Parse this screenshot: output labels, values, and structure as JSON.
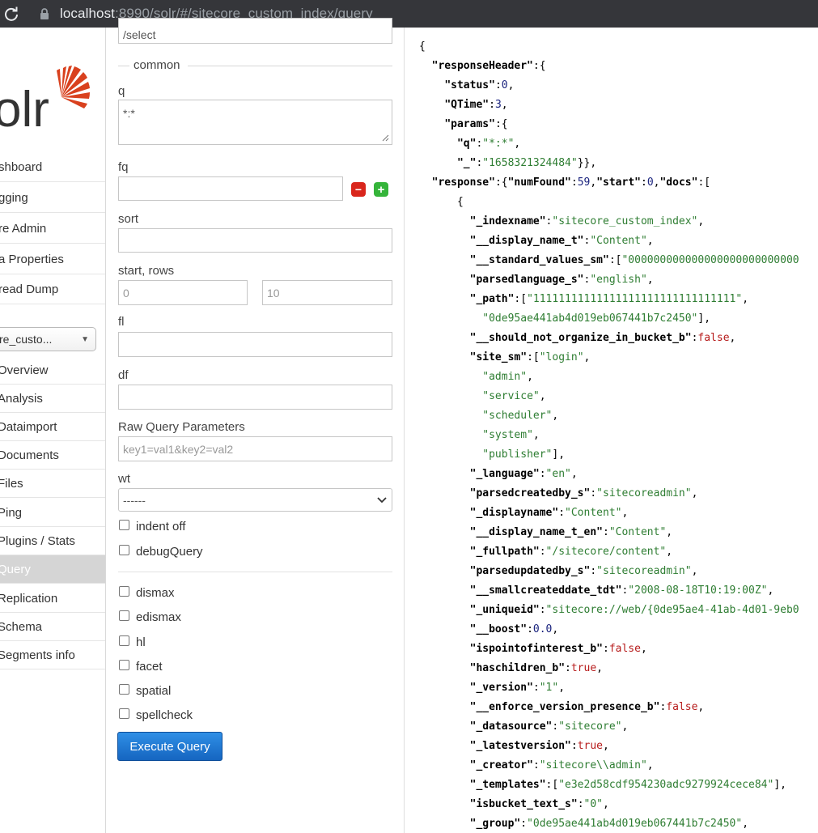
{
  "browser": {
    "url_host": "localhost",
    "url_rest": ":8990/solr/#/sitecore_custom_index/query"
  },
  "nav": {
    "logo_text": "olr",
    "items": [
      "shboard",
      "gging",
      "re Admin",
      "a Properties",
      "read Dump"
    ],
    "core_selected": "re_custo...",
    "core_items": [
      "Overview",
      "Analysis",
      "Dataimport",
      "Documents",
      "Files",
      "Ping",
      "Plugins / Stats",
      "Query",
      "Replication",
      "Schema",
      "Segments info"
    ],
    "active_core_item": "Query"
  },
  "form": {
    "handler_value": "/select",
    "common_legend": "common",
    "q_label": "q",
    "q_value": "*:*",
    "fq_label": "fq",
    "sort_label": "sort",
    "start_rows_label": "start, rows",
    "start_value": "0",
    "rows_value": "10",
    "fl_label": "fl",
    "df_label": "df",
    "raw_label": "Raw Query Parameters",
    "raw_placeholder": "key1=val1&key2=val2",
    "wt_label": "wt",
    "wt_value": "------",
    "indent_label": "indent off",
    "debug_label": "debugQuery",
    "options": [
      "dismax",
      "edismax",
      "hl",
      "facet",
      "spatial",
      "spellcheck"
    ],
    "execute_label": "Execute Query"
  },
  "response_json": [
    [
      [
        "p",
        "{"
      ]
    ],
    [
      [
        "i",
        "  "
      ],
      [
        "k",
        "\"responseHeader\""
      ],
      [
        "p",
        "\":{"
      ]
    ],
    [
      [
        "i",
        "    "
      ],
      [
        "k",
        "\"status\""
      ],
      [
        "p",
        ":"
      ],
      [
        "n",
        "0"
      ],
      [
        "p",
        ","
      ]
    ],
    [
      [
        "i",
        "    "
      ],
      [
        "k",
        "\"QTime\""
      ],
      [
        "p",
        ":"
      ],
      [
        "n",
        "3"
      ],
      [
        "p",
        ","
      ]
    ],
    [
      [
        "i",
        "    "
      ],
      [
        "k",
        "\"params\""
      ],
      [
        "p",
        ":{"
      ]
    ],
    [
      [
        "i",
        "      "
      ],
      [
        "k",
        "\"q\""
      ],
      [
        "p",
        ":"
      ],
      [
        "s",
        "\"*:*\""
      ],
      [
        "p",
        ","
      ]
    ],
    [
      [
        "i",
        "      "
      ],
      [
        "k",
        "\"_\""
      ],
      [
        "p",
        ":"
      ],
      [
        "s",
        "\"1658321324484\""
      ],
      [
        "p",
        "}},"
      ]
    ],
    [
      [
        "i",
        "  "
      ],
      [
        "k",
        "\"response\""
      ],
      [
        "p",
        ":{"
      ],
      [
        "k",
        "\"numFound\""
      ],
      [
        "p",
        ":"
      ],
      [
        "n",
        "59"
      ],
      [
        "p",
        ","
      ],
      [
        "k",
        "\"start\""
      ],
      [
        "p",
        ":"
      ],
      [
        "n",
        "0"
      ],
      [
        "p",
        ","
      ],
      [
        "k",
        "\"docs\""
      ],
      [
        "p",
        ":["
      ]
    ],
    [
      [
        "i",
        "      "
      ],
      [
        "p",
        "{"
      ]
    ],
    [
      [
        "i",
        "        "
      ],
      [
        "k",
        "\"_indexname\""
      ],
      [
        "p",
        ":"
      ],
      [
        "s",
        "\"sitecore_custom_index\""
      ],
      [
        "p",
        ","
      ]
    ],
    [
      [
        "i",
        "        "
      ],
      [
        "k",
        "\"__display_name_t\""
      ],
      [
        "p",
        ":"
      ],
      [
        "s",
        "\"Content\""
      ],
      [
        "p",
        ","
      ]
    ],
    [
      [
        "i",
        "        "
      ],
      [
        "k",
        "\"__standard_values_sm\""
      ],
      [
        "p",
        ":["
      ],
      [
        "s",
        "\"000000000000000000000000000"
      ]
    ],
    [
      [
        "i",
        "        "
      ],
      [
        "k",
        "\"parsedlanguage_s\""
      ],
      [
        "p",
        ":"
      ],
      [
        "s",
        "\"english\""
      ],
      [
        "p",
        ","
      ]
    ],
    [
      [
        "i",
        "        "
      ],
      [
        "k",
        "\"_path\""
      ],
      [
        "p",
        ":["
      ],
      [
        "s",
        "\"11111111111111111111111111111111\""
      ],
      [
        "p",
        ","
      ]
    ],
    [
      [
        "i",
        "          "
      ],
      [
        "s",
        "\"0de95ae441ab4d019eb067441b7c2450\""
      ],
      [
        "p",
        "],"
      ]
    ],
    [
      [
        "i",
        "        "
      ],
      [
        "k",
        "\"__should_not_organize_in_bucket_b\""
      ],
      [
        "p",
        ":"
      ],
      [
        "b",
        "false"
      ],
      [
        "p",
        ","
      ]
    ],
    [
      [
        "i",
        "        "
      ],
      [
        "k",
        "\"site_sm\""
      ],
      [
        "p",
        ":["
      ],
      [
        "s",
        "\"login\""
      ],
      [
        "p",
        ","
      ]
    ],
    [
      [
        "i",
        "          "
      ],
      [
        "s",
        "\"admin\""
      ],
      [
        "p",
        ","
      ]
    ],
    [
      [
        "i",
        "          "
      ],
      [
        "s",
        "\"service\""
      ],
      [
        "p",
        ","
      ]
    ],
    [
      [
        "i",
        "          "
      ],
      [
        "s",
        "\"scheduler\""
      ],
      [
        "p",
        ","
      ]
    ],
    [
      [
        "i",
        "          "
      ],
      [
        "s",
        "\"system\""
      ],
      [
        "p",
        ","
      ]
    ],
    [
      [
        "i",
        "          "
      ],
      [
        "s",
        "\"publisher\""
      ],
      [
        "p",
        "],"
      ]
    ],
    [
      [
        "i",
        "        "
      ],
      [
        "k",
        "\"_language\""
      ],
      [
        "p",
        ":"
      ],
      [
        "s",
        "\"en\""
      ],
      [
        "p",
        ","
      ]
    ],
    [
      [
        "i",
        "        "
      ],
      [
        "k",
        "\"parsedcreatedby_s\""
      ],
      [
        "p",
        ":"
      ],
      [
        "s",
        "\"sitecoreadmin\""
      ],
      [
        "p",
        ","
      ]
    ],
    [
      [
        "i",
        "        "
      ],
      [
        "k",
        "\"_displayname\""
      ],
      [
        "p",
        ":"
      ],
      [
        "s",
        "\"Content\""
      ],
      [
        "p",
        ","
      ]
    ],
    [
      [
        "i",
        "        "
      ],
      [
        "k",
        "\"__display_name_t_en\""
      ],
      [
        "p",
        ":"
      ],
      [
        "s",
        "\"Content\""
      ],
      [
        "p",
        ","
      ]
    ],
    [
      [
        "i",
        "        "
      ],
      [
        "k",
        "\"_fullpath\""
      ],
      [
        "p",
        ":"
      ],
      [
        "s",
        "\"/sitecore/content\""
      ],
      [
        "p",
        ","
      ]
    ],
    [
      [
        "i",
        "        "
      ],
      [
        "k",
        "\"parsedupdatedby_s\""
      ],
      [
        "p",
        ":"
      ],
      [
        "s",
        "\"sitecoreadmin\""
      ],
      [
        "p",
        ","
      ]
    ],
    [
      [
        "i",
        "        "
      ],
      [
        "k",
        "\"__smallcreateddate_tdt\""
      ],
      [
        "p",
        ":"
      ],
      [
        "s",
        "\"2008-08-18T10:19:00Z\""
      ],
      [
        "p",
        ","
      ]
    ],
    [
      [
        "i",
        "        "
      ],
      [
        "k",
        "\"_uniqueid\""
      ],
      [
        "p",
        ":"
      ],
      [
        "s",
        "\"sitecore://web/{0de95ae4-41ab-4d01-9eb0"
      ]
    ],
    [
      [
        "i",
        "        "
      ],
      [
        "k",
        "\"__boost\""
      ],
      [
        "p",
        ":"
      ],
      [
        "n",
        "0.0"
      ],
      [
        "p",
        ","
      ]
    ],
    [
      [
        "i",
        "        "
      ],
      [
        "k",
        "\"ispointofinterest_b\""
      ],
      [
        "p",
        ":"
      ],
      [
        "b",
        "false"
      ],
      [
        "p",
        ","
      ]
    ],
    [
      [
        "i",
        "        "
      ],
      [
        "k",
        "\"haschildren_b\""
      ],
      [
        "p",
        ":"
      ],
      [
        "b",
        "true"
      ],
      [
        "p",
        ","
      ]
    ],
    [
      [
        "i",
        "        "
      ],
      [
        "k",
        "\"_version\""
      ],
      [
        "p",
        ":"
      ],
      [
        "s",
        "\"1\""
      ],
      [
        "p",
        ","
      ]
    ],
    [
      [
        "i",
        "        "
      ],
      [
        "k",
        "\"__enforce_version_presence_b\""
      ],
      [
        "p",
        ":"
      ],
      [
        "b",
        "false"
      ],
      [
        "p",
        ","
      ]
    ],
    [
      [
        "i",
        "        "
      ],
      [
        "k",
        "\"_datasource\""
      ],
      [
        "p",
        ":"
      ],
      [
        "s",
        "\"sitecore\""
      ],
      [
        "p",
        ","
      ]
    ],
    [
      [
        "i",
        "        "
      ],
      [
        "k",
        "\"_latestversion\""
      ],
      [
        "p",
        ":"
      ],
      [
        "b",
        "true"
      ],
      [
        "p",
        ","
      ]
    ],
    [
      [
        "i",
        "        "
      ],
      [
        "k",
        "\"_creator\""
      ],
      [
        "p",
        ":"
      ],
      [
        "s",
        "\"sitecore\\\\admin\""
      ],
      [
        "p",
        ","
      ]
    ],
    [
      [
        "i",
        "        "
      ],
      [
        "k",
        "\"_templates\""
      ],
      [
        "p",
        ":["
      ],
      [
        "s",
        "\"e3e2d58cdf954230adc9279924cece84\""
      ],
      [
        "p",
        "],"
      ]
    ],
    [
      [
        "i",
        "        "
      ],
      [
        "k",
        "\"isbucket_text_s\""
      ],
      [
        "p",
        ":"
      ],
      [
        "s",
        "\"0\""
      ],
      [
        "p",
        ","
      ]
    ],
    [
      [
        "i",
        "        "
      ],
      [
        "k",
        "\"_group\""
      ],
      [
        "p",
        ":"
      ],
      [
        "s",
        "\"0de95ae441ab4d019eb067441b7c2450\""
      ],
      [
        "p",
        ","
      ]
    ]
  ]
}
